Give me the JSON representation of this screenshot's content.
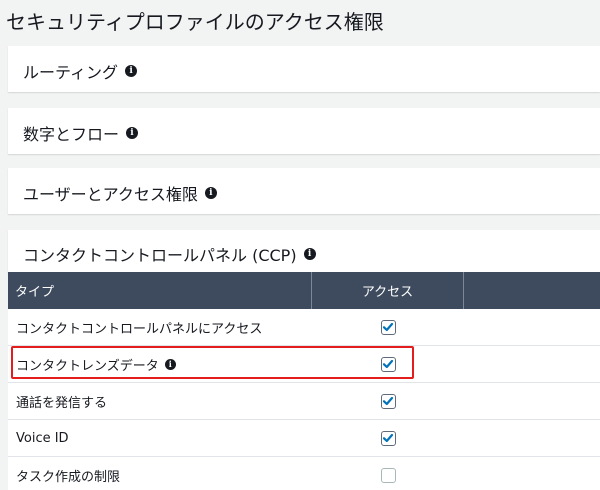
{
  "page": {
    "title": "セキュリティプロファイルのアクセス権限"
  },
  "sections": [
    {
      "label": "ルーティング"
    },
    {
      "label": "数字とフロー"
    },
    {
      "label": "ユーザーとアクセス権限"
    },
    {
      "label": "コンタクトコントロールパネル (CCP)"
    }
  ],
  "table": {
    "headers": {
      "type": "タイプ",
      "access": "アクセス"
    },
    "rows": [
      {
        "label": "コンタクトコントロールパネルにアクセス",
        "checked": true,
        "info": false
      },
      {
        "label": "コンタクトレンズデータ",
        "checked": true,
        "info": true
      },
      {
        "label": "通話を発信する",
        "checked": true,
        "info": false
      },
      {
        "label": "Voice ID",
        "checked": true,
        "info": false
      },
      {
        "label": "タスク作成の制限",
        "checked": false,
        "info": false
      }
    ]
  },
  "icons": {
    "info": "info-icon",
    "check": "checkmark-icon"
  },
  "colors": {
    "check": "#0073bb",
    "header_bg": "#3e4b5f",
    "highlight": "#e31d1d"
  }
}
